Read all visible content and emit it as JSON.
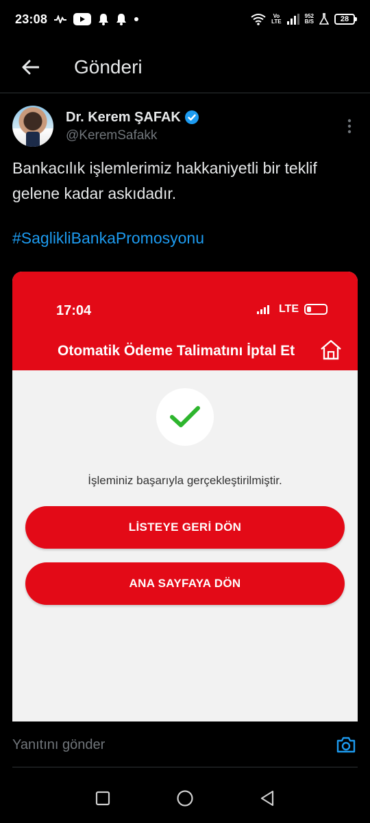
{
  "status_bar": {
    "time": "23:08",
    "volte_top": "Vo",
    "volte_bottom": "LTE",
    "speed_value": "952",
    "speed_unit": "B/S",
    "battery": "28"
  },
  "header": {
    "title": "Gönderi"
  },
  "post": {
    "author_name": "Dr. Kerem ŞAFAK",
    "author_handle": "@KeremSafakk",
    "text": "Bankacılık işlemlerimiz hakkaniyetli bir teklif gelene kadar askıdadır.",
    "hashtag": "#SaglikliBankaPromosyonu"
  },
  "embedded_screenshot": {
    "time": "17:04",
    "network": "LTE",
    "title": "Otomatik Ödeme Talimatını İptal Et",
    "success_message": "İşleminiz başarıyla gerçekleştirilmiştir.",
    "button_back_to_list": "LİSTEYE GERİ DÖN",
    "button_home": "ANA SAYFAYA DÖN"
  },
  "reply": {
    "placeholder": "Yanıtını gönder"
  },
  "colors": {
    "accent": "#1d9bf0",
    "bank_red": "#e30a17",
    "success_green": "#2db52d"
  }
}
